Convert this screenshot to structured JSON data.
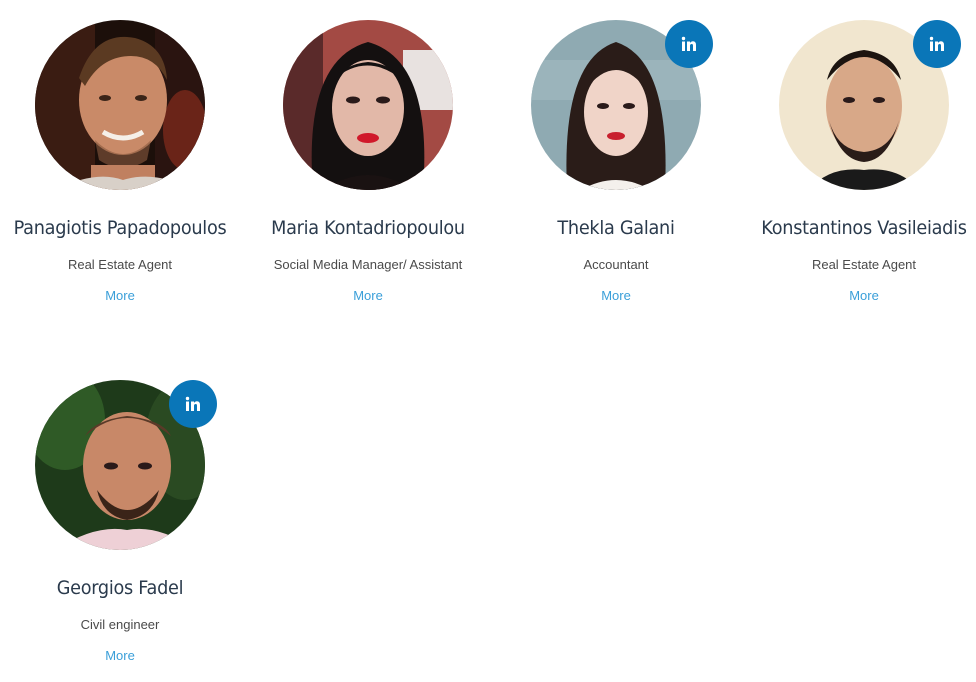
{
  "team": [
    {
      "name": "Panagiotis Papadopoulos",
      "role": "Real Estate Agent",
      "more_label": "More",
      "has_linkedin": false
    },
    {
      "name": "Maria Kontadriopoulou",
      "role": "Social Media Manager/ Assistant",
      "more_label": "More",
      "has_linkedin": false
    },
    {
      "name": "Thekla Galani",
      "role": "Accountant",
      "more_label": "More",
      "has_linkedin": true
    },
    {
      "name": "Konstantinos Vasileiadis",
      "role": "Real Estate Agent",
      "more_label": "More",
      "has_linkedin": true
    },
    {
      "name": "Georgios Fadel",
      "role": "Civil engineer",
      "more_label": "More",
      "has_linkedin": true
    }
  ],
  "linkedin_icon": "linkedin-icon",
  "colors": {
    "linkedin_bg": "#0a76b8",
    "name_text": "#2a3a4c",
    "link": "#3a9fd9"
  }
}
